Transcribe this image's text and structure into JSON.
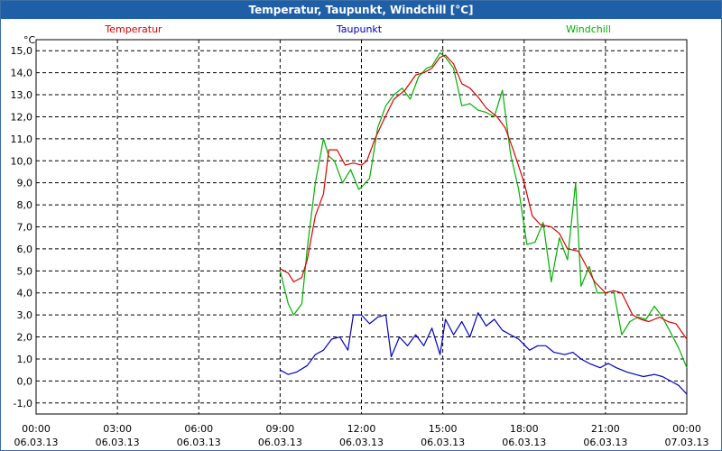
{
  "window": {
    "title": "Temperatur, Taupunkt, Windchill [°C]"
  },
  "chart_data": {
    "type": "line",
    "title": "Temperatur, Taupunkt, Windchill [°C]",
    "unit_label": "°C",
    "ylim": [
      -1.5,
      15.5
    ],
    "y_ticks": [
      "15,0",
      "14,0",
      "13,0",
      "12,0",
      "11,0",
      "10,0",
      "9,0",
      "8,0",
      "7,0",
      "6,0",
      "5,0",
      "4,0",
      "3,0",
      "2,0",
      "1,0",
      "0,0",
      "-1,0"
    ],
    "x_ticks": [
      {
        "time": "00:00",
        "date": "06.03.13"
      },
      {
        "time": "03:00",
        "date": "06.03.13"
      },
      {
        "time": "06:00",
        "date": "06.03.13"
      },
      {
        "time": "09:00",
        "date": "06.03.13"
      },
      {
        "time": "12:00",
        "date": "06.03.13"
      },
      {
        "time": "15:00",
        "date": "06.03.13"
      },
      {
        "time": "18:00",
        "date": "06.03.13"
      },
      {
        "time": "21:00",
        "date": "06.03.13"
      },
      {
        "time": "00:00",
        "date": "07.03.13"
      }
    ],
    "x_unit": "hours since 06.03.13 00:00",
    "grid": true,
    "series": [
      {
        "name": "Temperatur",
        "color": "#e00000",
        "x": [
          9.0,
          9.3,
          9.5,
          9.8,
          10.0,
          10.3,
          10.6,
          10.8,
          11.1,
          11.4,
          11.7,
          12.0,
          12.2,
          12.5,
          12.8,
          13.2,
          13.6,
          14.0,
          14.3,
          14.6,
          14.9,
          15.1,
          15.4,
          15.7,
          16.0,
          16.3,
          16.6,
          17.0,
          17.3,
          17.6,
          18.0,
          18.3,
          18.6,
          19.0,
          19.3,
          19.6,
          20.0,
          20.3,
          20.6,
          21.0,
          21.3,
          21.6,
          22.0,
          22.3,
          22.6,
          23.0,
          23.3,
          23.6,
          24.0
        ],
        "values": [
          5.1,
          4.9,
          4.5,
          4.7,
          5.5,
          7.5,
          8.5,
          10.5,
          10.5,
          9.8,
          9.9,
          9.8,
          10.0,
          11.0,
          11.8,
          12.8,
          13.2,
          13.9,
          14.0,
          14.2,
          14.7,
          14.8,
          14.4,
          13.5,
          13.3,
          12.9,
          12.4,
          12.0,
          11.5,
          10.5,
          9.0,
          7.5,
          7.1,
          7.0,
          6.7,
          6.0,
          5.9,
          5.2,
          4.5,
          4.0,
          4.1,
          4.0,
          3.0,
          2.8,
          2.7,
          2.9,
          2.7,
          2.6,
          1.9
        ]
      },
      {
        "name": "Taupunkt",
        "color": "#0000c0",
        "x": [
          9.0,
          9.3,
          9.6,
          10.0,
          10.3,
          10.6,
          10.9,
          11.2,
          11.5,
          11.7,
          12.0,
          12.3,
          12.6,
          12.9,
          13.1,
          13.4,
          13.7,
          14.0,
          14.3,
          14.6,
          14.9,
          15.1,
          15.4,
          15.7,
          16.0,
          16.3,
          16.6,
          16.9,
          17.2,
          17.5,
          17.8,
          18.2,
          18.5,
          18.8,
          19.1,
          19.5,
          19.8,
          20.1,
          20.4,
          20.8,
          21.1,
          21.4,
          21.8,
          22.1,
          22.4,
          22.8,
          23.1,
          23.4,
          23.7,
          24.0
        ],
        "values": [
          0.5,
          0.3,
          0.4,
          0.7,
          1.2,
          1.4,
          1.9,
          2.0,
          1.4,
          3.0,
          3.0,
          2.6,
          2.9,
          3.0,
          1.1,
          2.0,
          1.6,
          2.1,
          1.6,
          2.4,
          1.2,
          2.8,
          2.1,
          2.7,
          2.0,
          3.1,
          2.5,
          2.8,
          2.3,
          2.1,
          1.9,
          1.4,
          1.6,
          1.6,
          1.3,
          1.2,
          1.3,
          1.0,
          0.8,
          0.6,
          0.8,
          0.6,
          0.4,
          0.3,
          0.2,
          0.3,
          0.2,
          0.0,
          -0.2,
          -0.6
        ]
      },
      {
        "name": "Windchill",
        "color": "#00b000",
        "x": [
          9.0,
          9.3,
          9.5,
          9.8,
          10.0,
          10.3,
          10.6,
          10.8,
          11.0,
          11.3,
          11.6,
          11.9,
          12.0,
          12.3,
          12.6,
          12.9,
          13.2,
          13.5,
          13.8,
          14.1,
          14.4,
          14.6,
          14.9,
          15.1,
          15.4,
          15.7,
          16.0,
          16.3,
          16.6,
          16.9,
          17.2,
          17.5,
          17.8,
          18.1,
          18.4,
          18.7,
          19.0,
          19.3,
          19.6,
          19.9,
          20.1,
          20.4,
          20.7,
          21.0,
          21.3,
          21.6,
          21.9,
          22.2,
          22.5,
          22.8,
          23.1,
          23.4,
          23.7,
          24.0
        ],
        "values": [
          5.0,
          3.5,
          3.0,
          3.5,
          6.0,
          9.0,
          11.0,
          10.2,
          10.0,
          9.0,
          9.6,
          8.7,
          8.8,
          9.2,
          11.5,
          12.5,
          13.0,
          13.3,
          12.8,
          13.8,
          14.2,
          14.3,
          14.9,
          14.7,
          14.2,
          12.5,
          12.6,
          12.3,
          12.2,
          12.0,
          13.2,
          10.3,
          8.7,
          6.2,
          6.3,
          7.2,
          4.5,
          6.5,
          5.5,
          9.0,
          4.3,
          5.2,
          4.0,
          4.0,
          4.1,
          2.1,
          2.7,
          2.9,
          2.8,
          3.4,
          2.9,
          2.2,
          1.5,
          0.6
        ]
      }
    ]
  }
}
